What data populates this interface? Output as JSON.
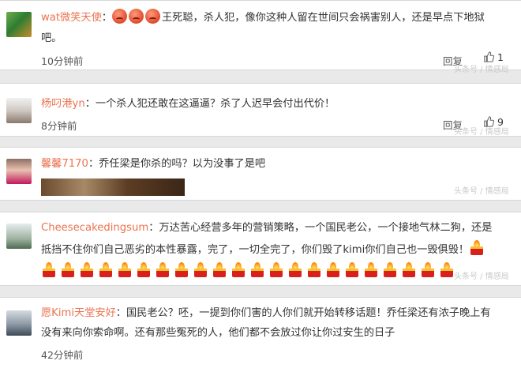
{
  "comments": [
    {
      "username": "wat微笑天使",
      "separator": "：",
      "text_line1": "王死聪，杀人犯，像你这种人留在世间只会祸害别人，还是早点下地狱",
      "text_line2": "吧。",
      "time": "10分钟前",
      "reply": "回复",
      "likes": "1",
      "watermark": "头条号 / 情感局"
    },
    {
      "username": "杨叼港yn",
      "separator": "：",
      "text_line1": "一个杀人犯还敢在这逼逼？杀了人迟早会付出代价！",
      "time": "8分钟前",
      "reply": "回复",
      "likes": "9",
      "watermark": "头条号 / 情感局"
    },
    {
      "username": "馨馨7170",
      "separator": "：",
      "text_line1": "乔任梁是你杀的吗？以为没事了是吧",
      "watermark": "头条号 / 情感局"
    },
    {
      "username": "Cheesecakedingsum",
      "separator": "：",
      "text_line1": "万达苦心经营多年的营销策略，一个国民老公，一个接地气林二狗，还是",
      "text_line2": "抵挡不住你们自己恶劣的本性暴露，完了，一切全完了，你们毁了kimi你们自己也一毁俱毁！",
      "candle_count": 22,
      "watermark": "头条号 / 情感局"
    },
    {
      "username": "愿Kimi天堂安好",
      "separator": "：",
      "text_line1": "国民老公？呸，一提到你们害的人你们就开始转移话题！乔任梁还有浓子晚上有",
      "text_line2": "没有来向你索命啊。还有那些冤死的人，他们都不会放过你让你过安生的日子",
      "time": "42分钟前"
    }
  ],
  "colors": {
    "username": "#eb7350",
    "text": "#333333",
    "time": "#555555",
    "candle": "#d9201a"
  }
}
